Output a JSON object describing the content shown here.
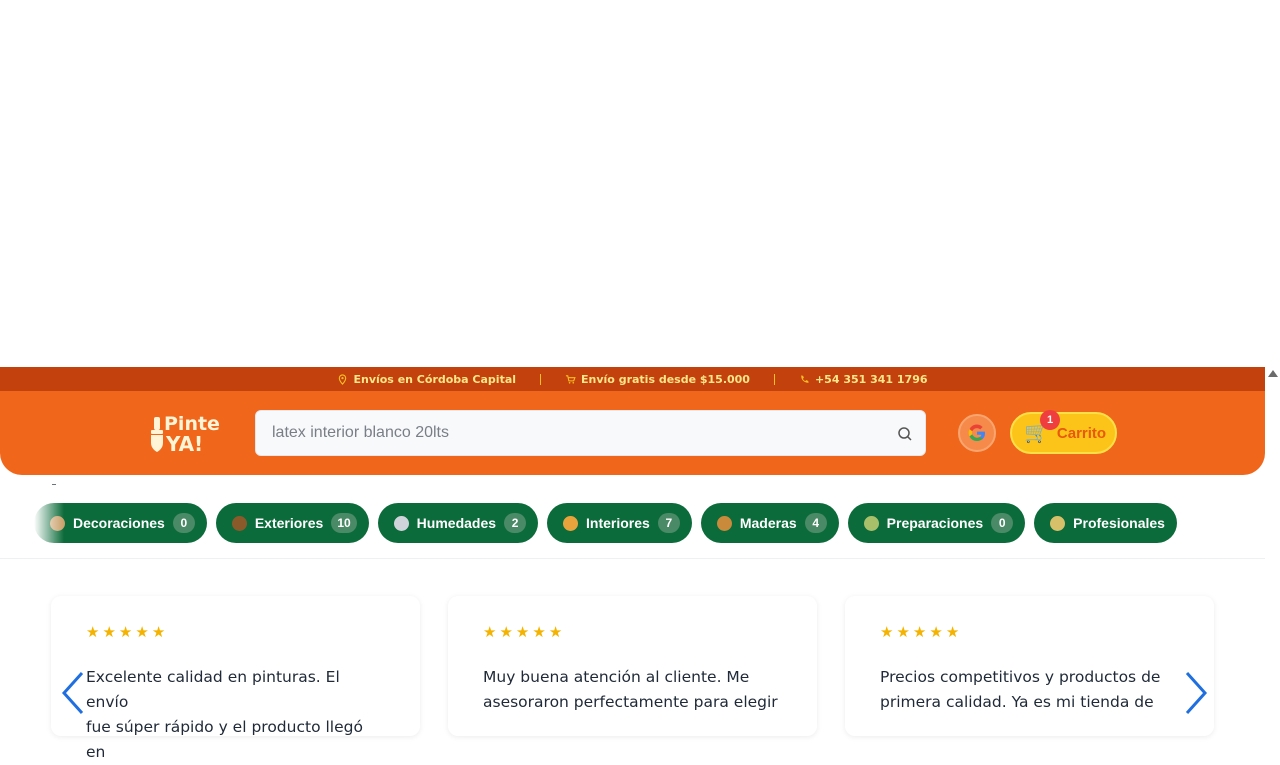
{
  "topbar": {
    "items": [
      {
        "icon": "location-pin-icon",
        "text": "Envíos en Córdoba Capital"
      },
      {
        "icon": "cart-small-icon",
        "text": "Envío gratis desde $15.000"
      },
      {
        "icon": "phone-icon",
        "text": "+54 351 341 1796"
      }
    ]
  },
  "header": {
    "logo_line1": "Pinte",
    "logo_line2": "YA!",
    "search_placeholder": "latex interior blanco 20lts",
    "cart_label": "Carrito",
    "cart_count": "1"
  },
  "categories": [
    {
      "label": "Decoraciones",
      "count": "0",
      "icon_color": "#c9a06a"
    },
    {
      "label": "Exteriores",
      "count": "10",
      "icon_color": "#8b5a2b"
    },
    {
      "label": "Humedades",
      "count": "2",
      "icon_color": "#cfd4da"
    },
    {
      "label": "Interiores",
      "count": "7",
      "icon_color": "#e8a33c"
    },
    {
      "label": "Maderas",
      "count": "4",
      "icon_color": "#c98a3c"
    },
    {
      "label": "Preparaciones",
      "count": "0",
      "icon_color": "#a8c06a"
    },
    {
      "label": "Profesionales",
      "count": "",
      "icon_color": "#d7c06a"
    }
  ],
  "reviews": [
    {
      "rating": 5,
      "line1": "Excelente calidad en pinturas. El envío",
      "line2": "fue súper rápido y el producto llegó en"
    },
    {
      "rating": 5,
      "line1": "Muy buena atención al cliente. Me",
      "line2": "asesoraron perfectamente para elegir"
    },
    {
      "rating": 5,
      "line1": "Precios competitivos y productos de",
      "line2": "primera calidad. Ya es mi tienda de"
    }
  ],
  "colors": {
    "topbar_bg": "#c2410c",
    "header_bg": "#f0661a",
    "category_bg": "#0b6b3a",
    "cart_bg": "#fcc419",
    "star": "#f5b301",
    "arrow": "#1f6fe0"
  }
}
